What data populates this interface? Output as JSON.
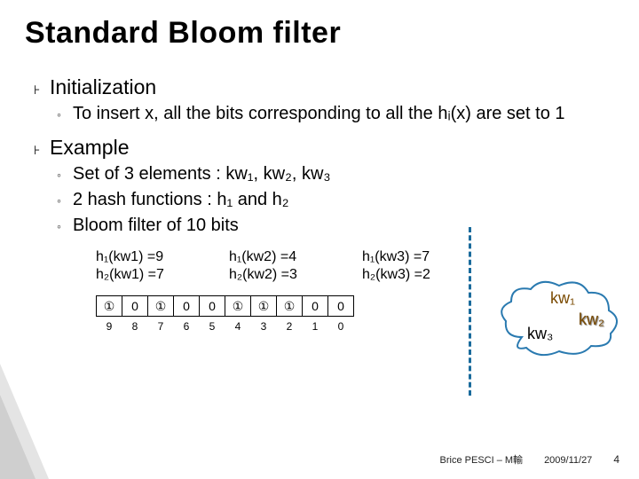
{
  "title": "Standard Bloom filter",
  "bullets": {
    "init_label": "Initialization",
    "init_sub": "To insert x, all the bits corresponding to all the hᵢ(x) are set to 1",
    "ex_label": "Example",
    "ex_subs": [
      "Set of 3 elements : kw₁, kw₂, kw₃",
      "2 hash functions : h₁ and h₂",
      "Bloom filter of 10 bits"
    ]
  },
  "hashes": [
    {
      "a": "h₁(kw1) =9",
      "b": "h₂(kw1) =7"
    },
    {
      "a": "h₁(kw2) =4",
      "b": "h₂(kw2) =3"
    },
    {
      "a": "h₁(kw3) =7",
      "b": "h₂(kw3) =2"
    }
  ],
  "filter": {
    "bits": [
      "①",
      "0",
      "①",
      "0",
      "0",
      "①",
      "①",
      "①",
      "0",
      "0"
    ],
    "indices": [
      "9",
      "8",
      "7",
      "6",
      "5",
      "4",
      "3",
      "2",
      "1",
      "0"
    ]
  },
  "cloud": {
    "kw1": "kw₁",
    "kw2": "kw₂",
    "kw3": "kw₃"
  },
  "footer": {
    "author": "Brice PESCI – M輸",
    "date": "2009/11/27",
    "page": "4"
  },
  "chart_data": {
    "type": "table",
    "title": "Bloom filter of 10 bits after inserting kw1, kw2, kw3",
    "hash_functions": {
      "h1": {
        "kw1": 9,
        "kw2": 4,
        "kw3": 7
      },
      "h2": {
        "kw1": 7,
        "kw2": 3,
        "kw3": 2
      }
    },
    "bit_indices": [
      9,
      8,
      7,
      6,
      5,
      4,
      3,
      2,
      1,
      0
    ],
    "bit_values": [
      1,
      0,
      1,
      0,
      0,
      1,
      1,
      1,
      0,
      0
    ],
    "elements": [
      "kw1",
      "kw2",
      "kw3"
    ]
  }
}
